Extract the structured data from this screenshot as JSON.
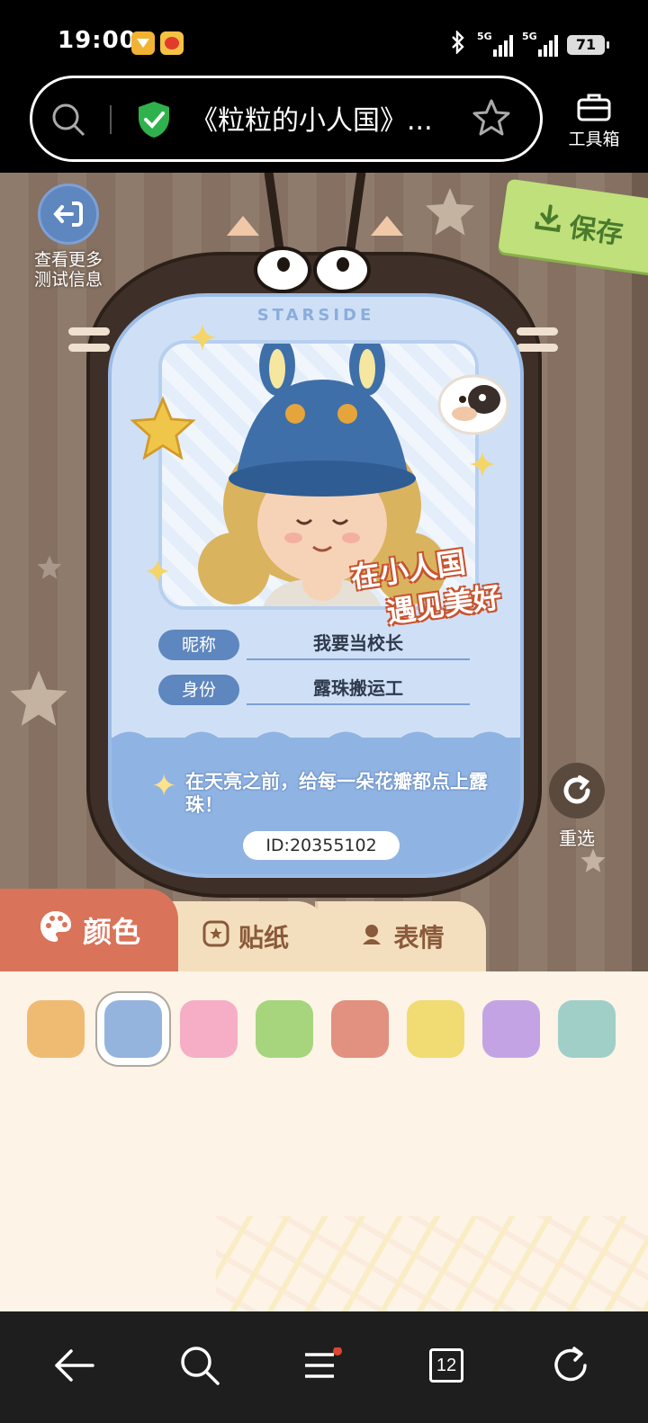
{
  "status_bar": {
    "time": "19:00",
    "network1": "5G",
    "network2": "5G",
    "battery": "71",
    "icons": [
      "app-notification-icon",
      "weibo-icon",
      "bluetooth-icon",
      "signal-icon",
      "battery-icon"
    ]
  },
  "browser": {
    "page_title": "《粒粒的小人国》...",
    "toolbox_label": "工具箱",
    "icons": [
      "search-icon",
      "shield-check-icon",
      "star-icon",
      "toolbox-icon"
    ]
  },
  "page": {
    "view_more_label": "查看更多\n测试信息",
    "save_label": "保存",
    "brand": "STARSIDE",
    "nickname_label": "昵称",
    "nickname_value": "我要当校长",
    "identity_label": "身份",
    "identity_value": "露珠搬运工",
    "slogan_line1": "在小人国",
    "slogan_line2": "遇见美好",
    "quote": "在天亮之前，给每一朵花瓣都点上露珠！",
    "id_text": "ID:20355102",
    "reselect_label": "重选"
  },
  "tabs": [
    {
      "label": "颜色",
      "icon": "palette-icon",
      "active": true
    },
    {
      "label": "贴纸",
      "icon": "sticker-icon",
      "active": false
    },
    {
      "label": "表情",
      "icon": "expression-icon",
      "active": false
    }
  ],
  "swatches": [
    {
      "color": "#efbb73",
      "selected": false
    },
    {
      "color": "#94b4de",
      "selected": true
    },
    {
      "color": "#f5aec6",
      "selected": false
    },
    {
      "color": "#a6d57d",
      "selected": false
    },
    {
      "color": "#e29080",
      "selected": false
    },
    {
      "color": "#f0dc72",
      "selected": false
    },
    {
      "color": "#c4a3e4",
      "selected": false
    },
    {
      "color": "#a0cfc8",
      "selected": false
    }
  ],
  "navbar": {
    "tab_count": "12",
    "icons": [
      "back-arrow-icon",
      "search-icon",
      "menu-icon",
      "tabs-icon",
      "refresh-icon"
    ]
  },
  "colors": {
    "accent_tab": "#d9735a",
    "save_button": "#bfe07a",
    "card_blue": "#cfe0f6",
    "badge_brown": "#3e3028"
  }
}
